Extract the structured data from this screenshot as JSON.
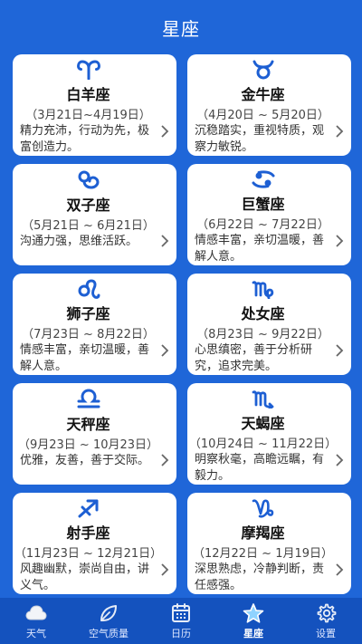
{
  "header": {
    "title": "星座"
  },
  "signs": [
    {
      "icon": "aries-icon",
      "name": "白羊座",
      "dates": "（3月21日~4月19日）",
      "desc": "精力充沛，行动为先，极富创造力。"
    },
    {
      "icon": "taurus-icon",
      "name": "金牛座",
      "dates": "（4月20日 ~ 5月20日）",
      "desc": "沉稳踏实，重视特质，观察力敏锐。"
    },
    {
      "icon": "gemini-icon",
      "name": "双子座",
      "dates": "（5月21日 ~ 6月21日）",
      "desc": "沟通力强，思维活跃。"
    },
    {
      "icon": "cancer-icon",
      "name": "巨蟹座",
      "dates": "（6月22日 ~ 7月22日）",
      "desc": "情感丰富，亲切温暖，善解人意。"
    },
    {
      "icon": "leo-icon",
      "name": "狮子座",
      "dates": "（7月23日 ~ 8月22日）",
      "desc": "情感丰富，亲切温暖，善解人意。"
    },
    {
      "icon": "virgo-icon",
      "name": "处女座",
      "dates": "（8月23日 ~ 9月22日）",
      "desc": "心思缜密，善于分析研究，追求完美。"
    },
    {
      "icon": "libra-icon",
      "name": "天秤座",
      "dates": "（9月23日 ~ 10月23日）",
      "desc": "优雅，友善，善于交际。"
    },
    {
      "icon": "scorpio-icon",
      "name": "天蝎座",
      "dates": "（10月24日 ~ 11月22日）",
      "desc": "明察秋毫，高瞻远瞩，有毅力。"
    },
    {
      "icon": "sagittarius-icon",
      "name": "射手座",
      "dates": "（11月23日 ~ 12月21日）",
      "desc": "风趣幽默，崇尚自由，讲义气。"
    },
    {
      "icon": "capricorn-icon",
      "name": "摩羯座",
      "dates": "（12月22日 ~ 1月19日）",
      "desc": "深思熟虑，冷静判断，责任感强。"
    }
  ],
  "tabs": [
    {
      "icon": "cloud-icon",
      "label": "天气"
    },
    {
      "icon": "leaf-icon",
      "label": "空气质量"
    },
    {
      "icon": "calendar-icon",
      "label": "日历"
    },
    {
      "icon": "star-icon",
      "label": "星座"
    },
    {
      "icon": "gear-icon",
      "label": "设置"
    }
  ],
  "colors": {
    "background": "#1f66d8",
    "tabbar": "#1452be",
    "accent": "#1d5fd3",
    "card": "#ffffff"
  }
}
